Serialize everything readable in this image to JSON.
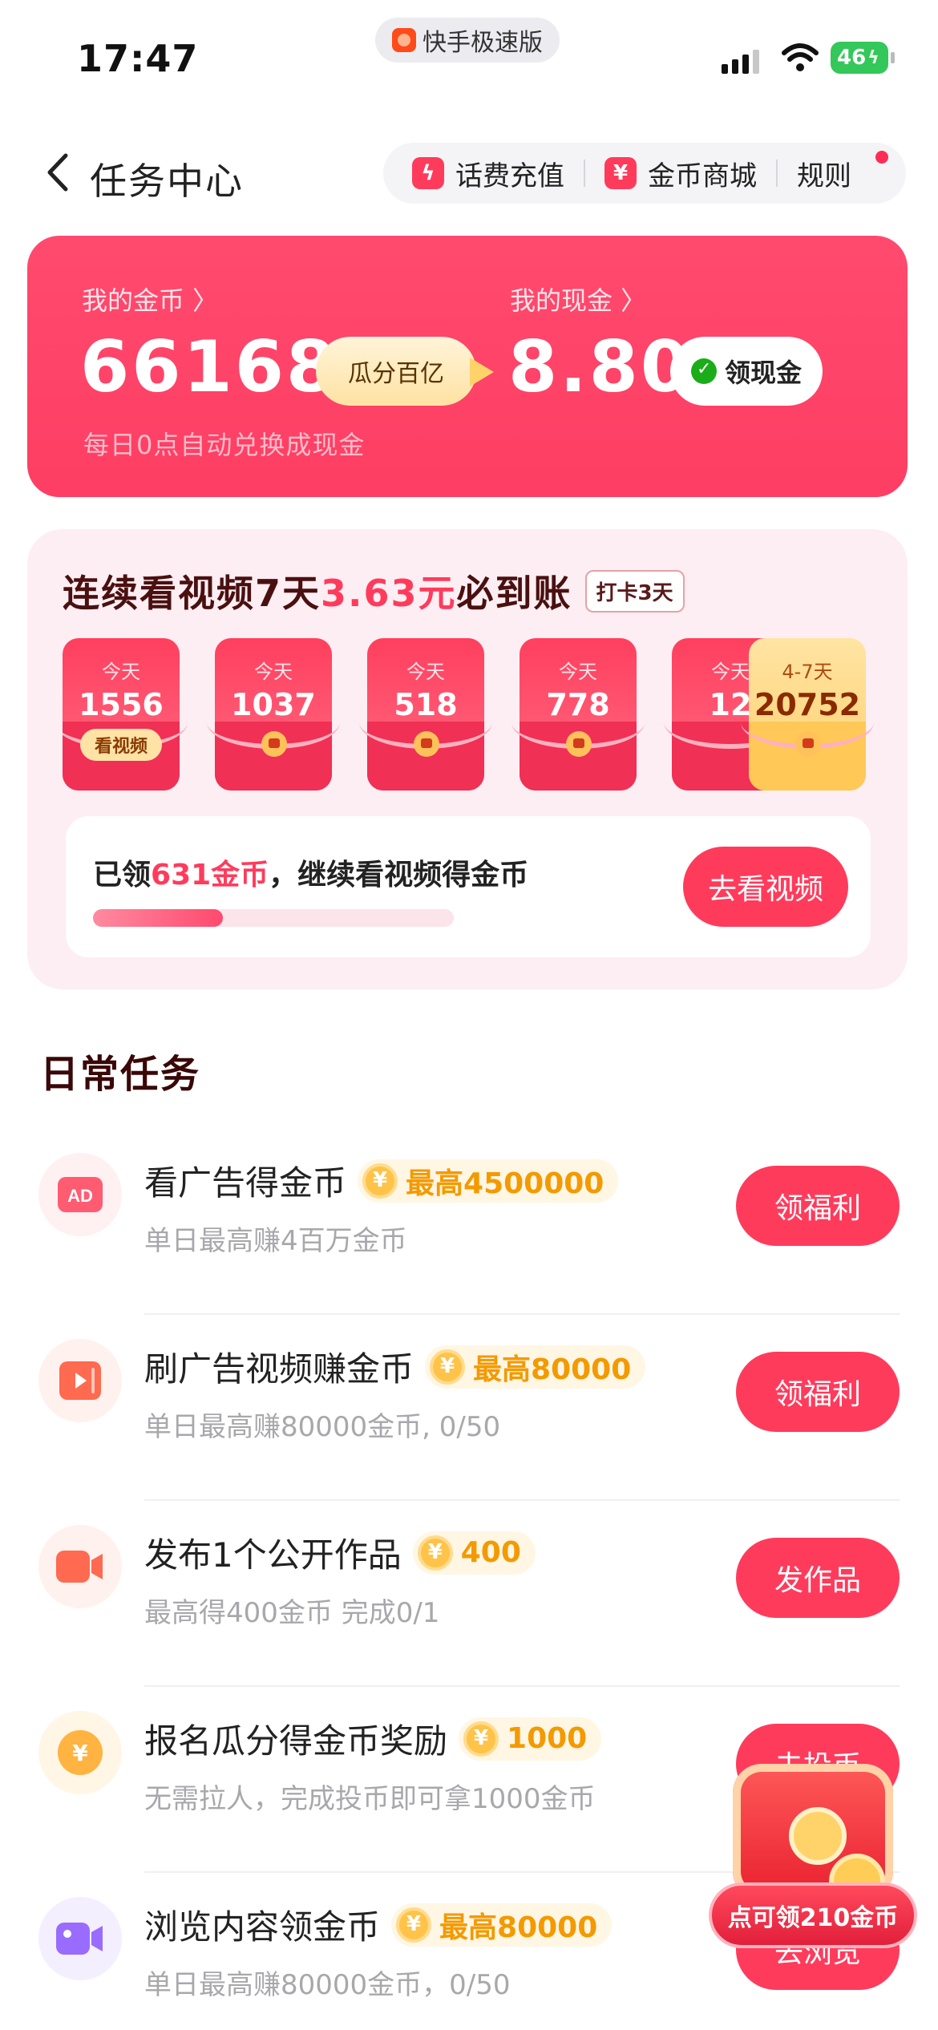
{
  "status_bar": {
    "time": "17:47",
    "app_name": "快手极速版",
    "battery": "46"
  },
  "header": {
    "title": "任务中心",
    "actions": {
      "recharge": "话费充值",
      "recharge_icon": "ϟ",
      "mall": "金币商城",
      "mall_icon": "¥",
      "rules": "规则"
    }
  },
  "wallet": {
    "coins_label": "我的金币 〉",
    "coins_value": "66168",
    "split_label": "瓜分百亿",
    "cash_label": "我的现金 〉",
    "cash_value": "8.80",
    "cash_button": "领现金",
    "note": "每日0点自动兑换成现金"
  },
  "streak": {
    "title_pre": "连续看视频7天",
    "title_amount": "3.63元",
    "title_post": "必到账",
    "tag": "打卡3天",
    "envelopes": [
      {
        "day": "今天",
        "amount": "1556",
        "chip": "看视频"
      },
      {
        "day": "今天",
        "amount": "1037"
      },
      {
        "day": "今天",
        "amount": "518"
      },
      {
        "day": "今天",
        "amount": "778"
      },
      {
        "day": "今天",
        "amount": "12"
      },
      {
        "day": "4-7天",
        "amount": "20752"
      }
    ],
    "progress_pre": "已领",
    "progress_num": "631金币",
    "progress_post": "，继续看视频得金币",
    "progress_fraction": 0.36,
    "watch_button": "去看视频"
  },
  "daily": {
    "title": "日常任务",
    "tasks": [
      {
        "title": "看广告得金币",
        "badge": "最高4500000",
        "sub": "单日最高赚4百万金币",
        "button": "领福利",
        "icon": "ad-icon",
        "color": "#ff5c72",
        "bg": "#fff0f2"
      },
      {
        "title": "刷广告视频赚金币",
        "badge": "最高80000",
        "sub": "单日最高赚80000金币, 0/50",
        "button": "领福利",
        "icon": "video-play-icon",
        "color": "#ff6a50",
        "bg": "#fff1ee"
      },
      {
        "title": "发布1个公开作品",
        "badge": "400",
        "sub": "最高得400金币 完成0/1",
        "button": "发作品",
        "icon": "camera-icon",
        "color": "#ff6a50",
        "bg": "#fff1ee"
      },
      {
        "title": "报名瓜分得金币奖励",
        "badge": "1000",
        "sub": "无需拉人，完成投币即可拿1000金币",
        "button": "去投币",
        "icon": "yuan-coin-icon",
        "color": "#ffb340",
        "bg": "#fff6e6"
      },
      {
        "title": "浏览内容领金币",
        "badge": "最高80000",
        "sub": "单日最高赚80000金币，0/50",
        "button": "去浏览",
        "icon": "video-camera-icon",
        "color": "#9a6bff",
        "bg": "#f4efff"
      }
    ]
  },
  "float_reward": {
    "label": "点可领210金币"
  },
  "colors": {
    "accent": "#ff3b5c",
    "gold": "#f39a00"
  }
}
